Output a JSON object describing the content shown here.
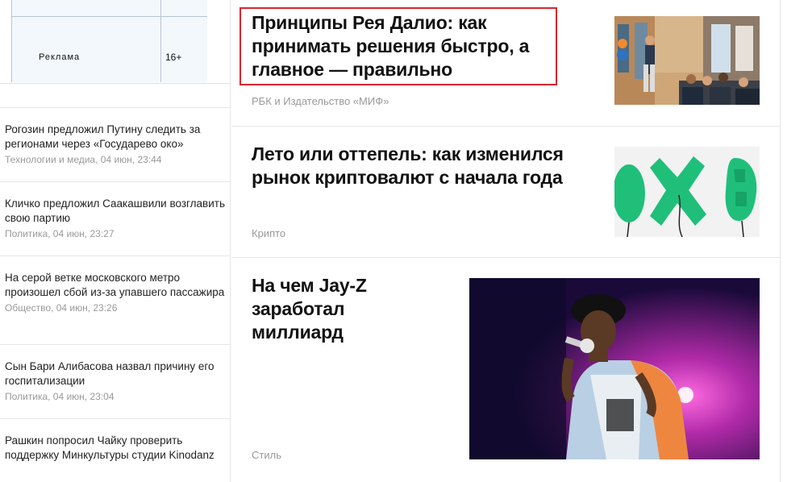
{
  "ad": {
    "label": "Реклама",
    "age": "16+"
  },
  "news": [
    {
      "title": "Рогозин предложил Путину следить за регионами через «Государево око»",
      "meta": "Технологии и медиа, 04 июн, 23:44"
    },
    {
      "title": "Кличко предложил Саакашвили возглавить свою партию",
      "meta": "Политика, 04 июн, 23:27"
    },
    {
      "title": "На серой ветке московского метро произошел сбой из-за упавшего пассажира",
      "meta": "Общество, 04 июн, 23:26"
    },
    {
      "title": "Сын Бари Алибасова назвал причину его госпитализации",
      "meta": "Политика, 04 июн, 23:04"
    },
    {
      "title": "Рашкин попросил Чайку проверить поддержку Минкультуры студии Kinodanz",
      "meta": ""
    }
  ],
  "articles": [
    {
      "title": "Принципы Рея Далио: как принимать решения быстро, а главное — правильно",
      "source": "РБК и Издательство «МИФ»"
    },
    {
      "title": "Лето или оттепель: как изменился рынок криптовалют с начала года",
      "source": "Крипто"
    },
    {
      "title": "На чем Jay-Z заработал миллиард",
      "source": "Стиль"
    }
  ],
  "colors": {
    "highlight": "#d9262d",
    "balloon": "#1fbf7a",
    "meta": "#999999"
  }
}
